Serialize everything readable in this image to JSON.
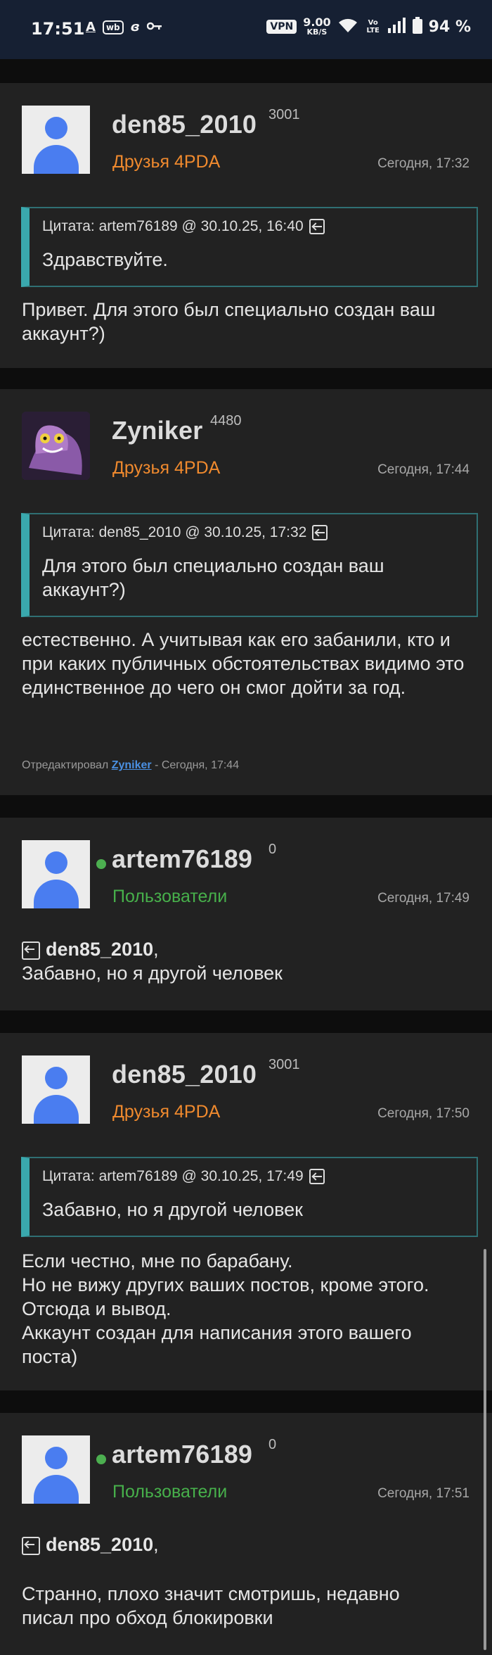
{
  "statusbar": {
    "time": "17:51",
    "icon_a": "A",
    "icon_wb": "wb",
    "icon_bc": "ɞ",
    "icon_key": "key-icon",
    "vpn": "VPN",
    "speed_value": "9.00",
    "speed_unit": "KB/S",
    "wifi_label": "4",
    "volte": "Vo LTE",
    "battery": "94 %"
  },
  "posts": [
    {
      "username": "den85_2010",
      "rep": "3001",
      "group": "Друзья 4PDA",
      "date": "Сегодня, 17:32",
      "quote_head": "Цитата: artem76189 @ 30.10.25, 16:40",
      "quote_text": "Здравствуйте.",
      "message": "Привет. Для этого был специально создан ваш аккаунт?)"
    },
    {
      "username": "Zyniker",
      "rep": "4480",
      "group": "Друзья 4PDA",
      "date": "Сегодня, 17:44",
      "quote_head": "Цитата: den85_2010 @ 30.10.25, 17:32",
      "quote_text": "Для этого был специально создан ваш аккаунт?)",
      "message": "естественно.  А учитывая как его забанили, кто и при каких публичных обстоятельствах видимо это единственное до чего он смог дойти за год.",
      "edited_prefix": "Отредактировал",
      "edited_user": "Zyniker",
      "edited_suffix": "- Сегодня, 17:44"
    },
    {
      "username": "artem76189",
      "rep": "0",
      "group": "Пользователи",
      "date": "Сегодня, 17:49",
      "mention": "den85_2010",
      "message": "Забавно, но я другой человек"
    },
    {
      "username": "den85_2010",
      "rep": "3001",
      "group": "Друзья 4PDA",
      "date": "Сегодня, 17:50",
      "quote_head": "Цитата: artem76189 @ 30.10.25, 17:49",
      "quote_text": "Забавно, но я другой человек",
      "message_lines": [
        "Если честно, мне по барабану.",
        "Но не вижу других ваших постов, кроме этого.",
        "Отсюда и вывод.",
        "Аккаунт создан для написания этого вашего поста)"
      ]
    },
    {
      "username": "artem76189",
      "rep": "0",
      "group": "Пользователи",
      "date": "Сегодня, 17:51",
      "mention": "den85_2010",
      "message": "Странно, плохо значит смотришь, недавно писал про обход блокировки"
    }
  ]
}
